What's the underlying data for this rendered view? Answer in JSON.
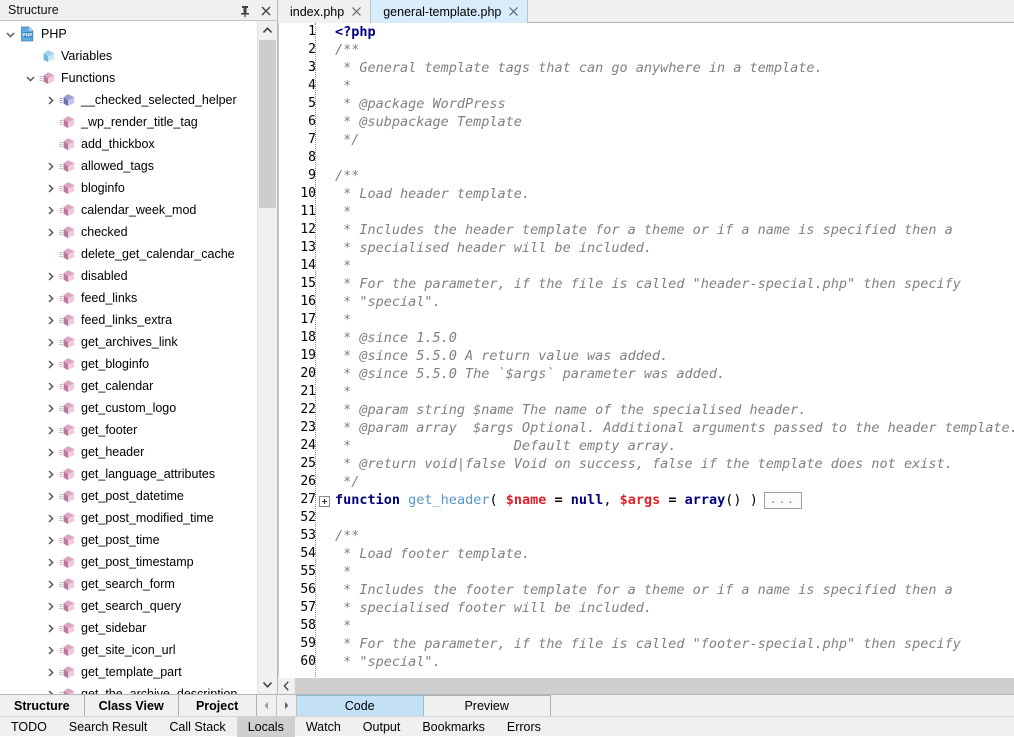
{
  "structure_panel": {
    "title": "Structure",
    "pin_icon": "pin-icon",
    "close_icon": "close-icon",
    "scroll_up_icon": "chevron-up-icon",
    "scroll_down_icon": "chevron-down-icon",
    "tree": [
      {
        "label": "PHP",
        "depth": 0,
        "twisty": "expanded",
        "icon": "php-file-icon"
      },
      {
        "label": "Variables",
        "depth": 1,
        "twisty": "none",
        "icon": "variables-cube-icon"
      },
      {
        "label": "Functions",
        "depth": 1,
        "twisty": "expanded",
        "icon": "functions-cube-icon"
      },
      {
        "label": "__checked_selected_helper",
        "depth": 2,
        "twisty": "collapsed",
        "icon": "function-blue-cube-icon"
      },
      {
        "label": "_wp_render_title_tag",
        "depth": 2,
        "twisty": "none",
        "icon": "function-cube-icon"
      },
      {
        "label": "add_thickbox",
        "depth": 2,
        "twisty": "none",
        "icon": "function-cube-icon"
      },
      {
        "label": "allowed_tags",
        "depth": 2,
        "twisty": "collapsed",
        "icon": "function-cube-icon"
      },
      {
        "label": "bloginfo",
        "depth": 2,
        "twisty": "collapsed",
        "icon": "function-cube-icon"
      },
      {
        "label": "calendar_week_mod",
        "depth": 2,
        "twisty": "collapsed",
        "icon": "function-cube-icon"
      },
      {
        "label": "checked",
        "depth": 2,
        "twisty": "collapsed",
        "icon": "function-cube-icon"
      },
      {
        "label": "delete_get_calendar_cache",
        "depth": 2,
        "twisty": "none",
        "icon": "function-cube-icon"
      },
      {
        "label": "disabled",
        "depth": 2,
        "twisty": "collapsed",
        "icon": "function-cube-icon"
      },
      {
        "label": "feed_links",
        "depth": 2,
        "twisty": "collapsed",
        "icon": "function-cube-icon"
      },
      {
        "label": "feed_links_extra",
        "depth": 2,
        "twisty": "collapsed",
        "icon": "function-cube-icon"
      },
      {
        "label": "get_archives_link",
        "depth": 2,
        "twisty": "collapsed",
        "icon": "function-cube-icon"
      },
      {
        "label": "get_bloginfo",
        "depth": 2,
        "twisty": "collapsed",
        "icon": "function-cube-icon"
      },
      {
        "label": "get_calendar",
        "depth": 2,
        "twisty": "collapsed",
        "icon": "function-cube-icon"
      },
      {
        "label": "get_custom_logo",
        "depth": 2,
        "twisty": "collapsed",
        "icon": "function-cube-icon"
      },
      {
        "label": "get_footer",
        "depth": 2,
        "twisty": "collapsed",
        "icon": "function-cube-icon"
      },
      {
        "label": "get_header",
        "depth": 2,
        "twisty": "collapsed",
        "icon": "function-cube-icon"
      },
      {
        "label": "get_language_attributes",
        "depth": 2,
        "twisty": "collapsed",
        "icon": "function-cube-icon"
      },
      {
        "label": "get_post_datetime",
        "depth": 2,
        "twisty": "collapsed",
        "icon": "function-cube-icon"
      },
      {
        "label": "get_post_modified_time",
        "depth": 2,
        "twisty": "collapsed",
        "icon": "function-cube-icon"
      },
      {
        "label": "get_post_time",
        "depth": 2,
        "twisty": "collapsed",
        "icon": "function-cube-icon"
      },
      {
        "label": "get_post_timestamp",
        "depth": 2,
        "twisty": "collapsed",
        "icon": "function-cube-icon"
      },
      {
        "label": "get_search_form",
        "depth": 2,
        "twisty": "collapsed",
        "icon": "function-cube-icon"
      },
      {
        "label": "get_search_query",
        "depth": 2,
        "twisty": "collapsed",
        "icon": "function-cube-icon"
      },
      {
        "label": "get_sidebar",
        "depth": 2,
        "twisty": "collapsed",
        "icon": "function-cube-icon"
      },
      {
        "label": "get_site_icon_url",
        "depth": 2,
        "twisty": "collapsed",
        "icon": "function-cube-icon"
      },
      {
        "label": "get_template_part",
        "depth": 2,
        "twisty": "collapsed",
        "icon": "function-cube-icon"
      },
      {
        "label": "get_the_archive_description",
        "depth": 2,
        "twisty": "collapsed",
        "icon": "function-cube-icon"
      }
    ]
  },
  "editor": {
    "tabs": [
      {
        "label": "index.php",
        "active": false,
        "close_icon": "close-icon"
      },
      {
        "label": "general-template.php",
        "active": true,
        "close_icon": "close-icon"
      }
    ],
    "horizontal_scroll_left_icon": "chevron-left-icon",
    "fold_placeholder": "...",
    "lines": [
      {
        "n": "1",
        "fold": "none"
      },
      {
        "n": "2",
        "fold": "none"
      },
      {
        "n": "3",
        "fold": "none"
      },
      {
        "n": "4",
        "fold": "none"
      },
      {
        "n": "5",
        "fold": "none"
      },
      {
        "n": "6",
        "fold": "none"
      },
      {
        "n": "7",
        "fold": "none"
      },
      {
        "n": "8",
        "fold": "none"
      },
      {
        "n": "9",
        "fold": "none"
      },
      {
        "n": "10",
        "fold": "none"
      },
      {
        "n": "11",
        "fold": "none"
      },
      {
        "n": "12",
        "fold": "none"
      },
      {
        "n": "13",
        "fold": "none"
      },
      {
        "n": "14",
        "fold": "none"
      },
      {
        "n": "15",
        "fold": "none"
      },
      {
        "n": "16",
        "fold": "none"
      },
      {
        "n": "17",
        "fold": "none"
      },
      {
        "n": "18",
        "fold": "none"
      },
      {
        "n": "19",
        "fold": "none"
      },
      {
        "n": "20",
        "fold": "none"
      },
      {
        "n": "21",
        "fold": "none"
      },
      {
        "n": "22",
        "fold": "none"
      },
      {
        "n": "23",
        "fold": "none"
      },
      {
        "n": "24",
        "fold": "none"
      },
      {
        "n": "25",
        "fold": "none"
      },
      {
        "n": "26",
        "fold": "none"
      },
      {
        "n": "27",
        "fold": "collapsed"
      },
      {
        "n": "52",
        "fold": "none"
      },
      {
        "n": "53",
        "fold": "none"
      },
      {
        "n": "54",
        "fold": "none"
      },
      {
        "n": "55",
        "fold": "none"
      },
      {
        "n": "56",
        "fold": "none"
      },
      {
        "n": "57",
        "fold": "none"
      },
      {
        "n": "58",
        "fold": "none"
      },
      {
        "n": "59",
        "fold": "none"
      },
      {
        "n": "60",
        "fold": "none"
      }
    ],
    "code_text": [
      "<?php",
      "/**",
      " * General template tags that can go anywhere in a template.",
      " *",
      " * @package WordPress",
      " * @subpackage Template",
      " */",
      "",
      "/**",
      " * Load header template.",
      " *",
      " * Includes the header template for a theme or if a name is specified then a",
      " * specialised header will be included.",
      " *",
      " * For the parameter, if the file is called \"header-special.php\" then specify",
      " * \"special\".",
      " *",
      " * @since 1.5.0",
      " * @since 5.5.0 A return value was added.",
      " * @since 5.5.0 The `$args` parameter was added.",
      " *",
      " * @param string $name The name of the specialised header.",
      " * @param array  $args Optional. Additional arguments passed to the header template.",
      " *                    Default empty array.",
      " * @return void|false Void on success, false if the template does not exist.",
      " */",
      "function get_header( $name = null, $args = array() )",
      "",
      "/**",
      " * Load footer template.",
      " *",
      " * Includes the footer template for a theme or if a name is specified then a",
      " * specialised footer will be included.",
      " *",
      " * For the parameter, if the file is called \"footer-special.php\" then specify",
      " * \"special\"."
    ]
  },
  "bottom_tabs": {
    "panel_tabs": [
      {
        "label": "Structure",
        "active": true
      },
      {
        "label": "Class View",
        "active": false
      },
      {
        "label": "Project",
        "active": false
      }
    ],
    "nav_left_icon": "triangle-left-icon",
    "nav_right_icon": "triangle-right-icon",
    "view_tabs": [
      {
        "label": "Code",
        "active": true
      },
      {
        "label": "Preview",
        "active": false
      }
    ]
  },
  "tool_strip": {
    "items": [
      {
        "label": "TODO",
        "selected": false
      },
      {
        "label": "Search Result",
        "selected": false
      },
      {
        "label": "Call Stack",
        "selected": false
      },
      {
        "label": "Locals",
        "selected": true
      },
      {
        "label": "Watch",
        "selected": false
      },
      {
        "label": "Output",
        "selected": false
      },
      {
        "label": "Bookmarks",
        "selected": false
      },
      {
        "label": "Errors",
        "selected": false
      }
    ]
  },
  "colors": {
    "accent_tab": "#c3e0f5",
    "active_editor_tab": "#d9ecfb",
    "chrome": "#f0f0f0",
    "comment": "#808080",
    "keyword": "#00007f",
    "function_name": "#5599c7",
    "variable": "#e0202c",
    "scrollbar_thumb": "#cdcdcd"
  }
}
